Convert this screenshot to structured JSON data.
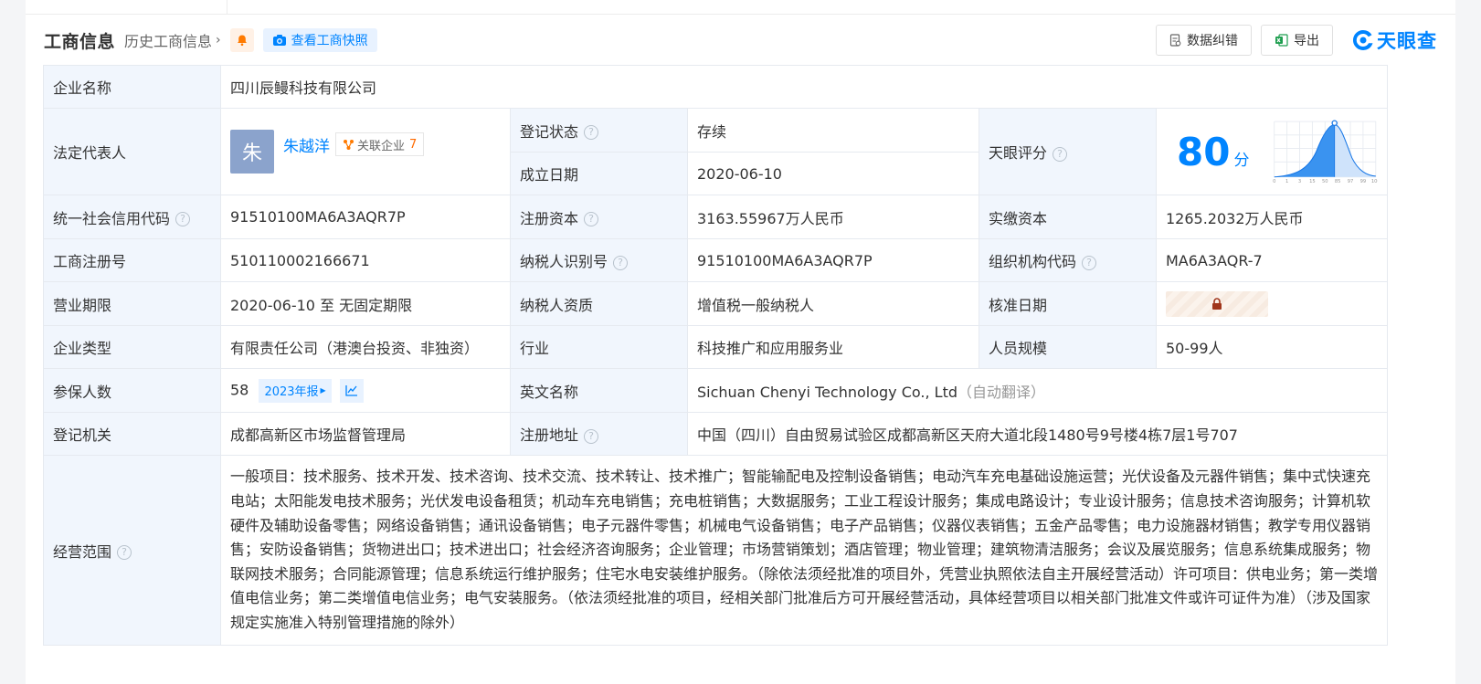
{
  "header": {
    "title": "工商信息",
    "history_link": "历史工商信息",
    "snapshot_button": "查看工商快照",
    "correction_button": "数据纠错",
    "export_button": "导出",
    "brand": "天眼查"
  },
  "rows": {
    "company_name_label": "企业名称",
    "company_name": "四川辰鳗科技有限公司",
    "legal_rep_label": "法定代表人",
    "legal_rep_avatar": "朱",
    "legal_rep_name": "朱越洋",
    "related_label": "关联企业",
    "related_count": "7",
    "reg_status_label": "登记状态",
    "reg_status": "存续",
    "established_label": "成立日期",
    "established": "2020-06-10",
    "tianyan_score_label": "天眼评分",
    "tianyan_score": "80",
    "tianyan_score_unit": "分",
    "credit_code_label": "统一社会信用代码",
    "credit_code": "91510100MA6A3AQR7P",
    "reg_capital_label": "注册资本",
    "reg_capital": "3163.55967万人民币",
    "paid_capital_label": "实缴资本",
    "paid_capital": "1265.2032万人民币",
    "business_reg_no_label": "工商注册号",
    "business_reg_no": "510110002166671",
    "taxpayer_id_label": "纳税人识别号",
    "taxpayer_id": "91510100MA6A3AQR7P",
    "org_code_label": "组织机构代码",
    "org_code": "MA6A3AQR-7",
    "term_label": "营业期限",
    "term": "2020-06-10 至 无固定期限",
    "taxpayer_qual_label": "纳税人资质",
    "taxpayer_qual": "增值税一般纳税人",
    "approval_date_label": "核准日期",
    "company_type_label": "企业类型",
    "company_type": "有限责任公司（港澳台投资、非独资）",
    "industry_label": "行业",
    "industry": "科技推广和应用服务业",
    "staff_size_label": "人员规模",
    "staff_size": "50-99人",
    "insured_label": "参保人数",
    "insured": "58",
    "insured_report": "2023年报",
    "english_name_label": "英文名称",
    "english_name": "Sichuan Chenyi Technology Co., Ltd",
    "english_name_note": "（自动翻译）",
    "authority_label": "登记机关",
    "authority": "成都高新区市场监督管理局",
    "address_label": "注册地址",
    "address": "中国（四川）自由贸易试验区成都高新区天府大道北段1480号9号楼4栋7层1号707",
    "scope_label": "经营范围",
    "scope": "一般项目：技术服务、技术开发、技术咨询、技术交流、技术转让、技术推广；智能输配电及控制设备销售；电动汽车充电基础设施运营；光伏设备及元器件销售；集中式快速充电站；太阳能发电技术服务；光伏发电设备租赁；机动车充电销售；充电桩销售；大数据服务；工业工程设计服务；集成电路设计；专业设计服务；信息技术咨询服务；计算机软硬件及辅助设备零售；网络设备销售；通讯设备销售；电子元器件零售；机械电气设备销售；电子产品销售；仪器仪表销售；五金产品零售；电力设施器材销售；教学专用仪器销售；安防设备销售；货物进出口；技术进出口；社会经济咨询服务；企业管理；市场营销策划；酒店管理；物业管理；建筑物清洁服务；会议及展览服务；信息系统集成服务；物联网技术服务；合同能源管理；信息系统运行维护服务；住宅水电安装维护服务。（除依法须经批准的项目外，凭营业执照依法自主开展经营活动）许可项目：供电业务；第一类增值电信业务；第二类增值电信业务；电气安装服务。（依法须经批准的项目，经相关部门批准后方可开展经营活动，具体经营项目以相关部门批准文件或许可证件为准）（涉及国家规定实施准入特别管理措施的除外）"
  },
  "score_chart": {
    "x_ticks": [
      "0",
      "1",
      "3",
      "15",
      "50",
      "85",
      "97",
      "99",
      "100"
    ],
    "marker_percentile": 85
  },
  "colors": {
    "accent": "#0084ff",
    "status_green": "#00a63d",
    "label_bg": "#f1f6fd"
  }
}
